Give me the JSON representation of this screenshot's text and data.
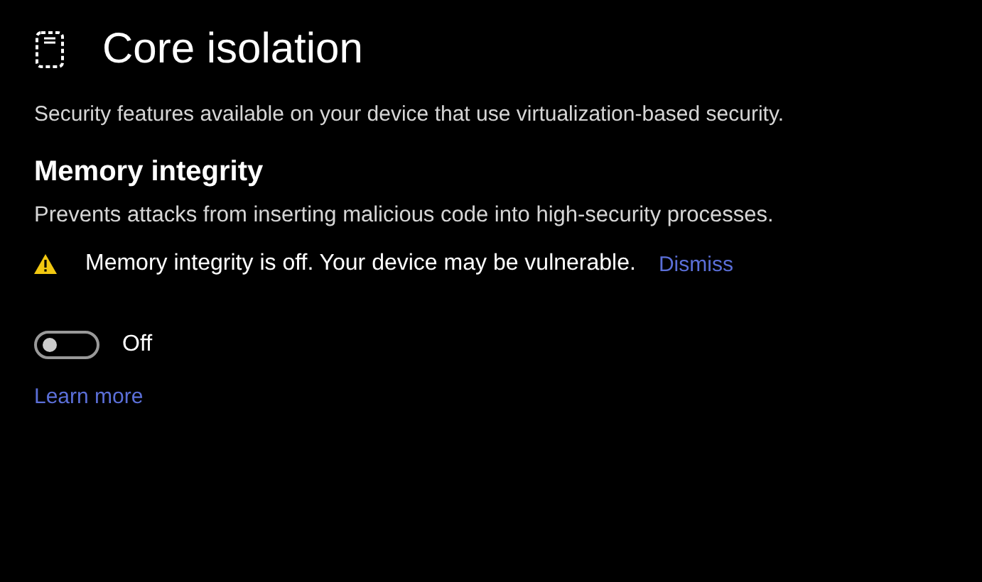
{
  "title": "Core isolation",
  "description": "Security features available on your device that use virtualization-based security.",
  "section": {
    "heading": "Memory integrity",
    "description": "Prevents attacks from inserting malicious code into high-security processes.",
    "warning": {
      "text": "Memory integrity is off. Your device may be vulnerable.",
      "action": "Dismiss"
    },
    "toggle": {
      "on": false,
      "label": "Off"
    },
    "link": "Learn more"
  }
}
